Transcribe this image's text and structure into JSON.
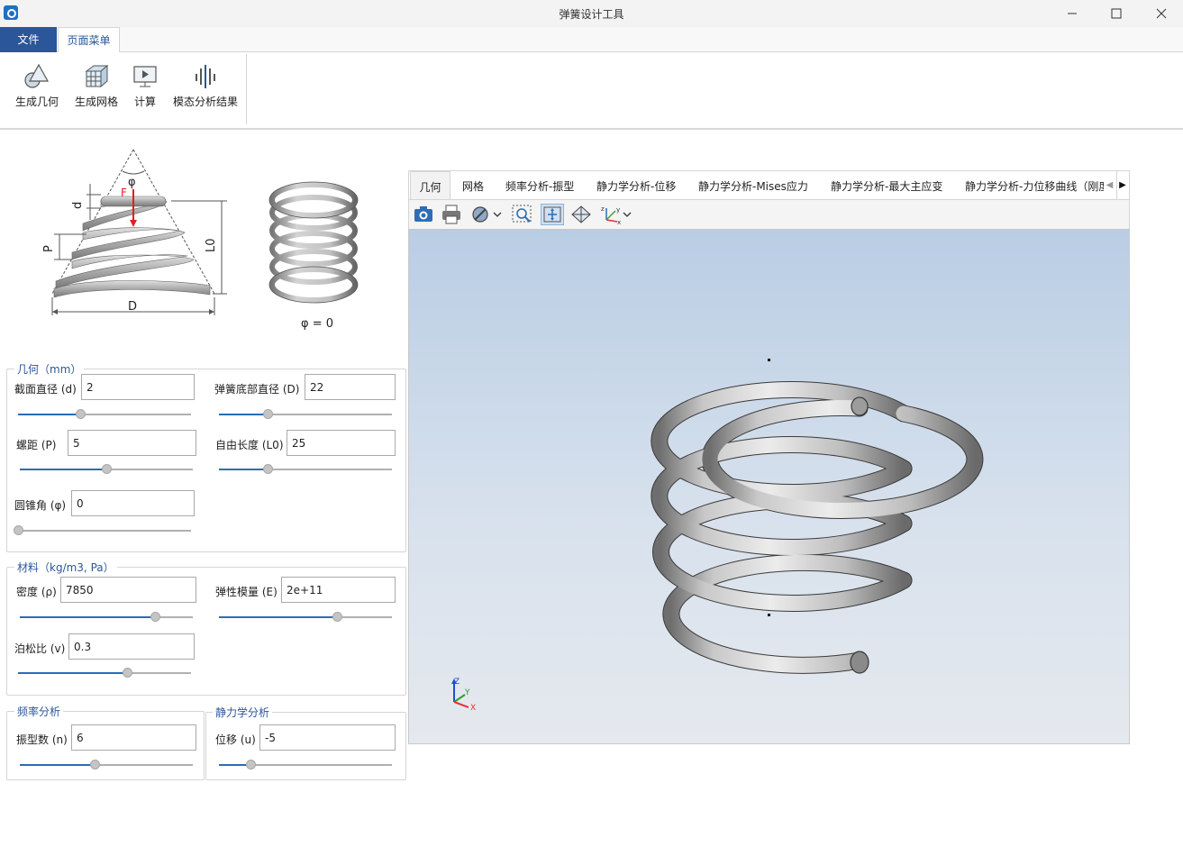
{
  "window": {
    "title": "弹簧设计工具"
  },
  "ribbon": {
    "tabs": [
      "文件",
      "页面菜单"
    ],
    "buttons": [
      "生成几何",
      "生成网格",
      "计算",
      "模态分析结果"
    ]
  },
  "diagram": {
    "labels": {
      "phi": "φ",
      "d": "d",
      "F": "F",
      "P": "P",
      "L0": "L0",
      "D": "D"
    },
    "caption": "φ = 0"
  },
  "geometry": {
    "title": "几何（mm）",
    "fields": [
      {
        "label": "截面直径 (d)",
        "value": "2",
        "slider": 0.36
      },
      {
        "label": "弹簧底部直径 (D)",
        "value": "22",
        "slider": 0.28
      },
      {
        "label": "螺距 (P)",
        "value": "5",
        "slider": 0.5
      },
      {
        "label": "自由长度 (L0)",
        "value": "25",
        "slider": 0.28
      },
      {
        "label": "圆锥角 (φ)",
        "value": "0",
        "slider": 0.0
      }
    ]
  },
  "material": {
    "title": "材料（kg/m3, Pa）",
    "fields": [
      {
        "label": "密度 (ρ)",
        "value": "7850",
        "slider": 0.78
      },
      {
        "label": "弹性模量 (E)",
        "value": "2e+11",
        "slider": 0.68
      },
      {
        "label": "泊松比 (v)",
        "value": "0.3",
        "slider": 0.63
      }
    ]
  },
  "frequency": {
    "title": "频率分析",
    "fields": [
      {
        "label": "振型数 (n)",
        "value": "6",
        "slider": 0.43
      }
    ]
  },
  "static": {
    "title": "静力学分析",
    "fields": [
      {
        "label": "位移 (u)",
        "value": "-5",
        "slider": 0.18
      }
    ]
  },
  "viewer": {
    "tabs": [
      "几何",
      "网格",
      "频率分析-振型",
      "静力学分析-位移",
      "静力学分析-Mises应力",
      "静力学分析-最大主应变",
      "静力学分析-力位移曲线（刚度"
    ],
    "active_tab": "几何",
    "toolbar_icons": [
      "camera-icon",
      "print-icon",
      "hide-icon",
      "chevron-down-icon",
      "zoom-window-icon",
      "fit-all-icon",
      "view-cube-icon",
      "axis-view-icon",
      "chevron-down-icon"
    ],
    "triad": {
      "z": "Z",
      "y": "Y",
      "x": "X"
    }
  },
  "colors": {
    "accent": "#2b579a",
    "slider_fill": "#2b6cb8",
    "viewer_top": "#b9cde4",
    "viewer_bottom": "#e5e9ee"
  }
}
